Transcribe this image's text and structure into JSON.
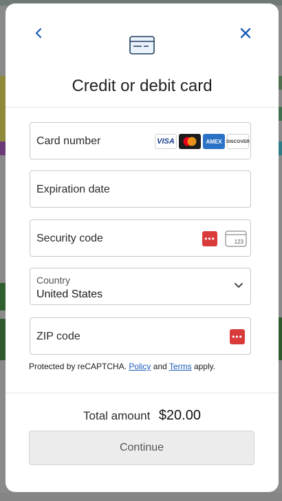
{
  "dialog": {
    "title": "Credit or debit card",
    "back_icon": "chevron-left-icon",
    "close_icon": "close-icon",
    "header_icon": "credit-card-icon"
  },
  "fields": {
    "card_number": {
      "label": "Card number",
      "value": ""
    },
    "expiration": {
      "label": "Expiration date",
      "value": ""
    },
    "security": {
      "label": "Security code",
      "value": "",
      "hint_text": "123"
    },
    "country": {
      "caption": "Country",
      "value": "United States"
    },
    "zip": {
      "label": "ZIP code",
      "value": ""
    }
  },
  "card_brands": [
    "VISA",
    "Mastercard",
    "AMEX",
    "DISCOVER"
  ],
  "recaptcha": {
    "prefix": "Protected by reCAPTCHA.",
    "policy": "Policy",
    "and": "and",
    "terms": "Terms",
    "suffix": "apply."
  },
  "total": {
    "label": "Total amount",
    "value": "$20.00"
  },
  "continue_label": "Continue",
  "colors": {
    "accent": "#1a5bb8",
    "cvv_red": "#d93a3a",
    "amex_blue": "#2a72c5",
    "button_bg": "#ececec"
  }
}
